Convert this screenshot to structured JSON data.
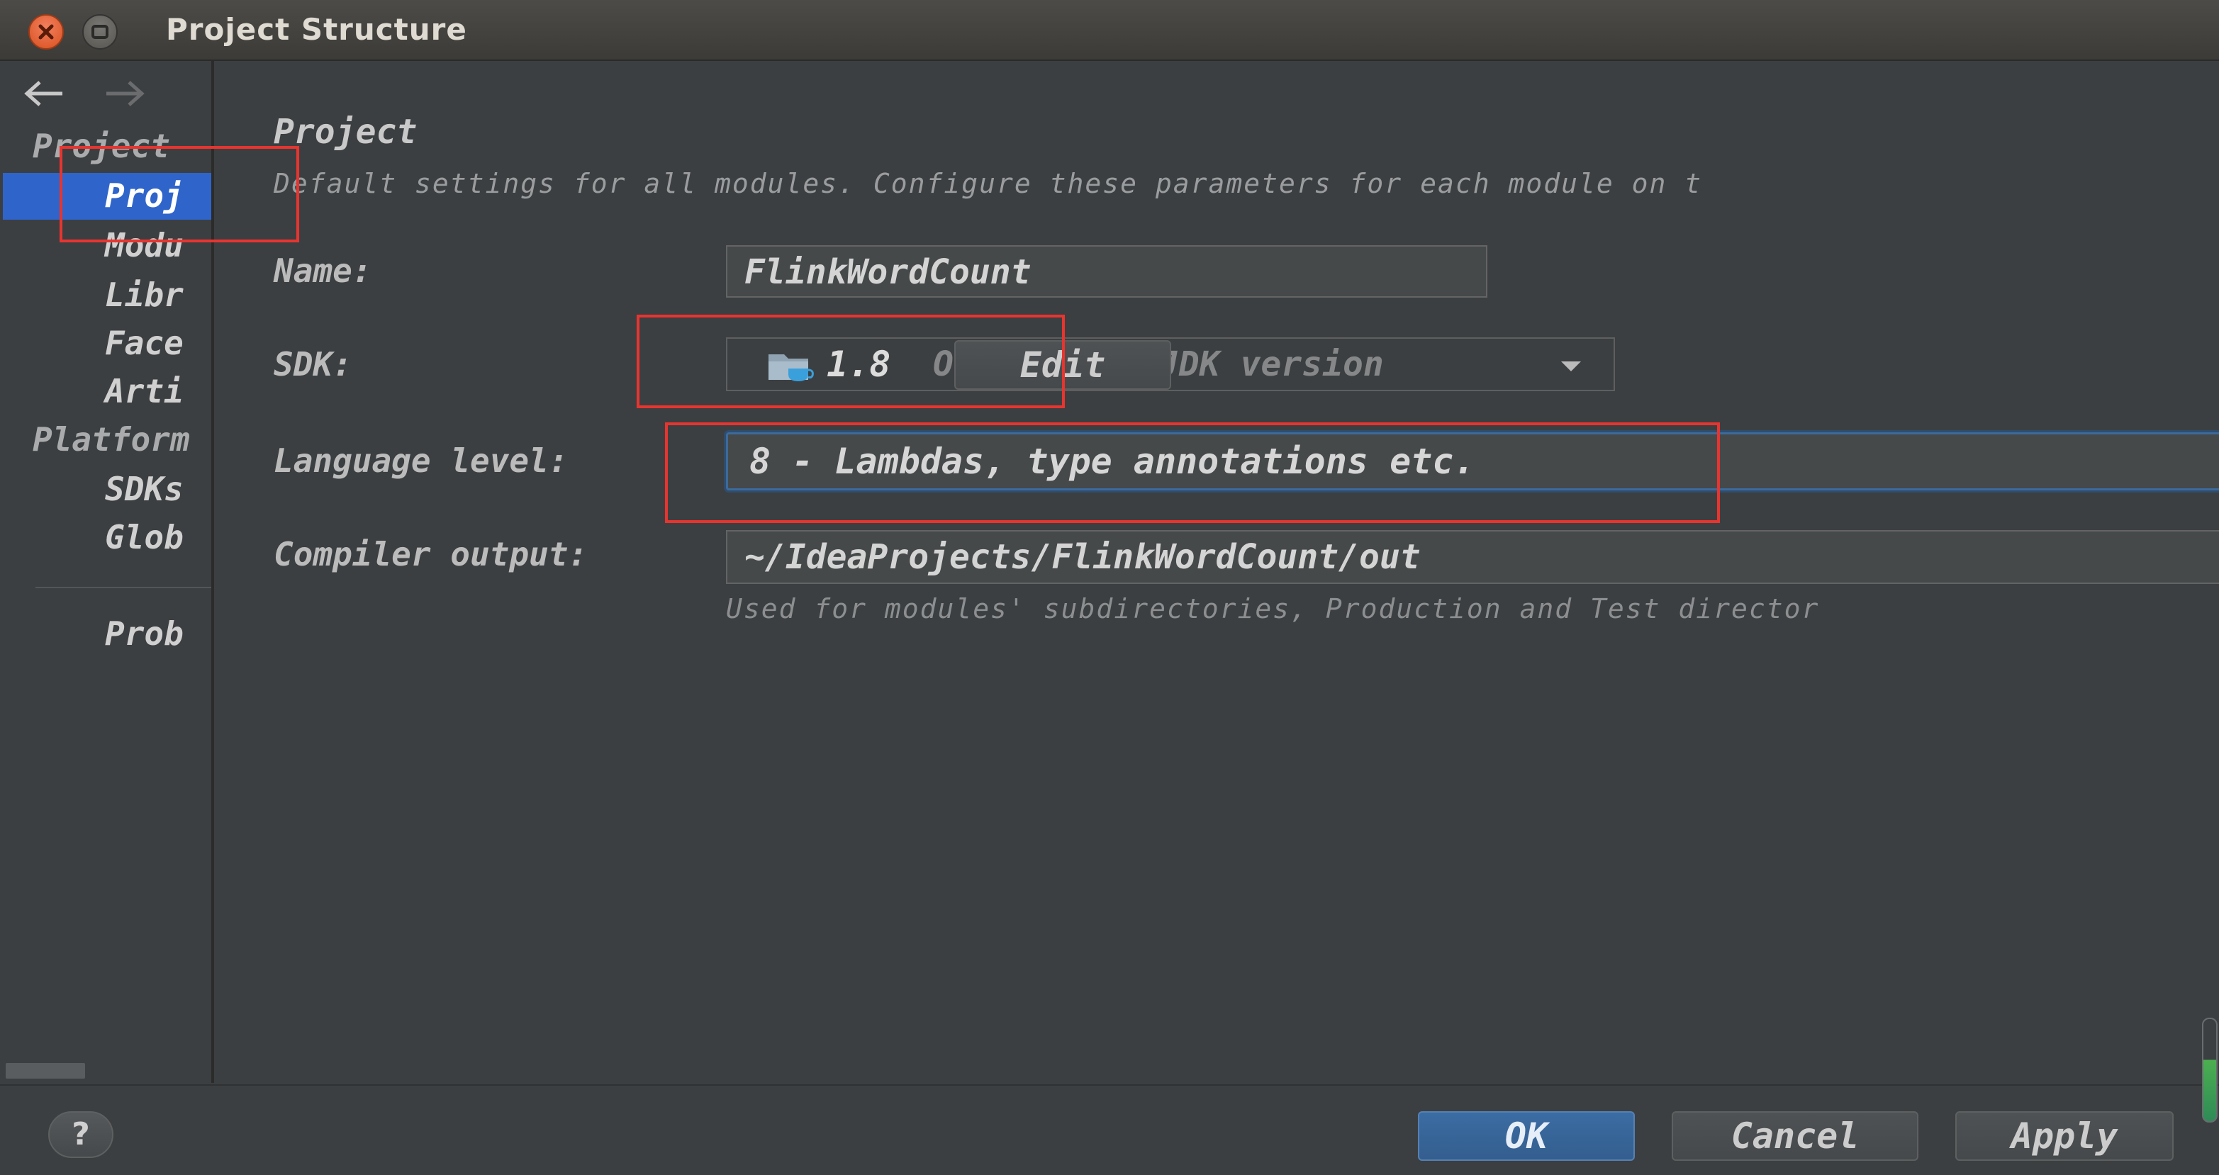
{
  "window": {
    "title": "Project Structure"
  },
  "sidebar": {
    "groups": [
      {
        "label": "Project"
      },
      {
        "label": "Platform"
      }
    ],
    "items": [
      {
        "label": "Proj",
        "selected": true
      },
      {
        "label": "Modu"
      },
      {
        "label": "Libr"
      },
      {
        "label": "Face"
      },
      {
        "label": "Arti"
      },
      {
        "label": "SDKs"
      },
      {
        "label": "Glob"
      },
      {
        "label": "Prob"
      }
    ]
  },
  "main": {
    "heading": "Project",
    "description": "Default settings for all modules. Configure these parameters for each module on t",
    "name": {
      "label": "Name:",
      "value": "FlinkWordCount"
    },
    "sdk": {
      "label": "SDK:",
      "version": "1.8",
      "description": "Oracle OpenJDK version",
      "edit_label": "Edit"
    },
    "language_level": {
      "label": "Language level:",
      "value": "8 - Lambdas, type annotations etc."
    },
    "compiler_output": {
      "label": "Compiler output:",
      "value": "~/IdeaProjects/FlinkWordCount/out",
      "hint": "Used for modules' subdirectories, Production and Test director"
    }
  },
  "footer": {
    "help_label": "?",
    "ok_label": "OK",
    "cancel_label": "Cancel",
    "apply_label": "Apply"
  },
  "colors": {
    "background": "#3c3f41",
    "selection": "#2f65ca",
    "annotation": "#e8342f",
    "ok_button": "#365f90",
    "focus_border": "#3d6a9a"
  },
  "icons": [
    "close-icon",
    "minimize-icon",
    "back-arrow-icon",
    "forward-arrow-icon",
    "jdk-folder-icon",
    "chevron-down-icon",
    "help-icon"
  ]
}
